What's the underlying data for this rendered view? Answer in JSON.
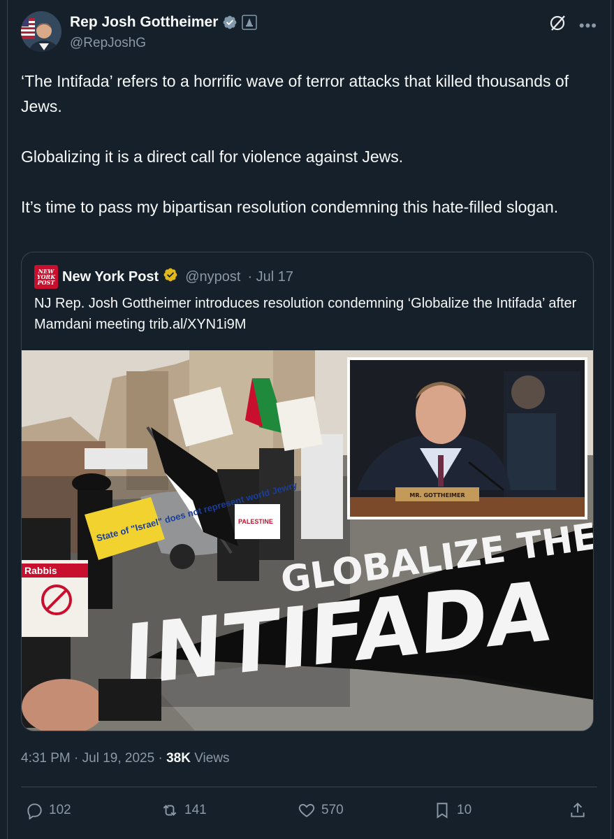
{
  "author": {
    "name": "Rep Josh Gottheimer",
    "handle": "@RepJoshG"
  },
  "tweet": {
    "paragraphs": [
      "‘The Intifada’ refers to a horrific wave of terror attacks that killed thousands of Jews.",
      "Globalizing it is a direct call for violence against Jews.",
      "It’s time to pass my bipartisan resolution condemning this hate-filled slogan."
    ]
  },
  "quote": {
    "logo_lines": [
      "NEW",
      "YORK",
      "POST"
    ],
    "name": "New York Post",
    "handle": "@nypost",
    "date": "· Jul 17",
    "text": "NJ Rep. Josh Gottheimer introduces resolution condemning ‘Globalize the Intifada’ after Mamdani meeting trib.al/XYN1i9M",
    "image": {
      "banner_line1": "GLOBALIZE THE",
      "banner_line2": "INTIFADA",
      "nameplate": "MR. GOTTHEIMER",
      "sign_text": "State of \"Israel\" does not represent world Jewry",
      "sign2_text": "Rabbis",
      "palestine_sign": "PALESTINE"
    }
  },
  "meta": {
    "time": "4:31 PM · Jul 19, 2025 ·",
    "views_count": "38K",
    "views_label": "Views"
  },
  "actions": {
    "replies": "102",
    "reposts": "141",
    "likes": "570",
    "bookmarks": "10"
  },
  "colors": {
    "background": "#15202b",
    "verified_blue": "#1d9bf0",
    "nypost_red": "#c8102e",
    "muted_text": "#8b98a5",
    "badge_gold": "#e2b719"
  }
}
